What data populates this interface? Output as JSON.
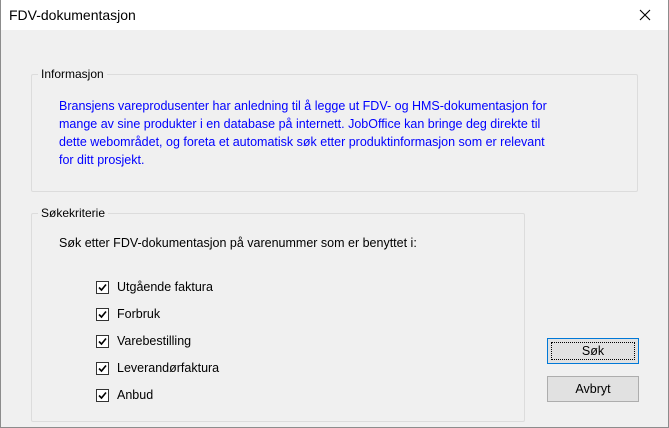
{
  "window": {
    "title": "FDV-dokumentasjon"
  },
  "info": {
    "legend": "Informasjon",
    "lines": [
      "Bransjens vareprodusenter har anledning til å legge ut FDV- og HMS-dokumentasjon for",
      "mange av sine produkter i en database på internett. JobOffice kan bringe deg direkte til",
      "dette webområdet, og foreta et automatisk søk etter produktinformasjon som er relevant",
      "for ditt prosjekt."
    ],
    "text_color": "#0000ff"
  },
  "search": {
    "legend": "Søkekriterie",
    "description": "Søk etter FDV-dokumentasjon på varenummer som er benyttet i:",
    "options": [
      {
        "label": "Utgående faktura",
        "checked": true
      },
      {
        "label": "Forbruk",
        "checked": true
      },
      {
        "label": "Varebestilling",
        "checked": true
      },
      {
        "label": "Leverandørfaktura",
        "checked": true
      },
      {
        "label": "Anbud",
        "checked": true
      }
    ]
  },
  "buttons": {
    "search_label": "Søk",
    "cancel_label": "Avbryt"
  },
  "icons": {
    "close": "close-icon",
    "check": "checkmark-icon"
  }
}
